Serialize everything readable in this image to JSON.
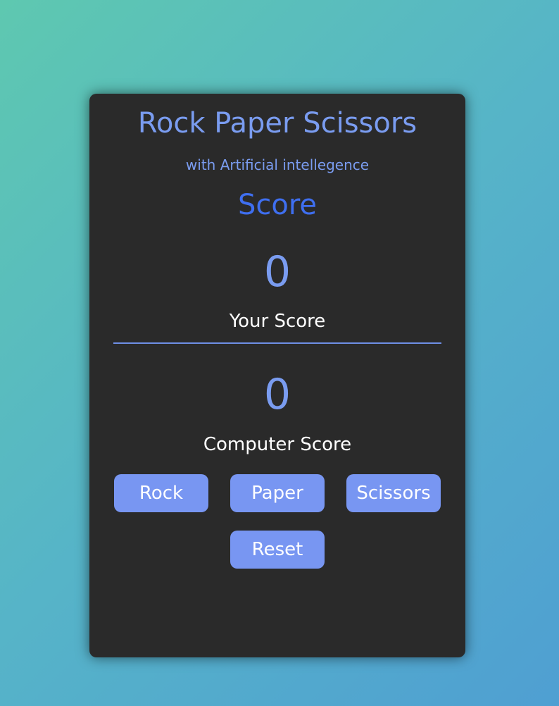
{
  "header": {
    "title": "Rock Paper Scissors",
    "subtitle": "with Artificial intellegence"
  },
  "score": {
    "heading": "Score",
    "player_value": "0",
    "player_label": "Your Score",
    "computer_value": "0",
    "computer_label": "Computer Score"
  },
  "controls": {
    "rock_label": "Rock",
    "paper_label": "Paper",
    "scissors_label": "Scissors",
    "reset_label": "Reset"
  },
  "colors": {
    "accent": "#7a9cf0",
    "heading": "#3f6ff0",
    "button": "#7896f2",
    "card": "#2a2a2a"
  }
}
